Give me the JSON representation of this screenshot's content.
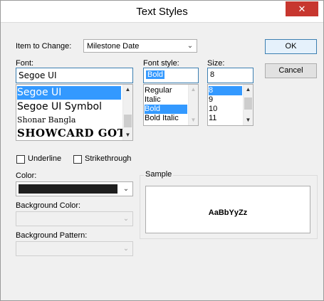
{
  "dialog": {
    "title": "Text Styles",
    "close_glyph": "✕"
  },
  "item_to_change": {
    "label": "Item to Change:",
    "value": "Milestone Date"
  },
  "buttons": {
    "ok": "OK",
    "cancel": "Cancel"
  },
  "font": {
    "label": "Font:",
    "value": "Segoe UI",
    "items": [
      "Segoe UI",
      "Segoe UI Symbol",
      "Shonar Bangla",
      "SHOWCARD GOTHIC"
    ],
    "selected": "Segoe UI"
  },
  "font_style": {
    "label": "Font style:",
    "value": "Bold",
    "items": [
      "Regular",
      "Italic",
      "Bold",
      "Bold Italic"
    ],
    "selected": "Bold"
  },
  "size": {
    "label": "Size:",
    "value": "8",
    "items": [
      "8",
      "9",
      "10",
      "11"
    ],
    "selected": "8"
  },
  "effects": {
    "underline": "Underline",
    "underline_checked": false,
    "strikethrough": "Strikethrough",
    "strikethrough_checked": false
  },
  "color": {
    "label": "Color:",
    "swatch": "#1e1e1e"
  },
  "background_color": {
    "label": "Background Color:"
  },
  "background_pattern": {
    "label": "Background Pattern:"
  },
  "sample": {
    "label": "Sample",
    "text": "AaBbYyZz"
  },
  "colors": {
    "selection": "#3399ff",
    "close_button": "#c7372f",
    "focus_border": "#3c7fb1"
  }
}
